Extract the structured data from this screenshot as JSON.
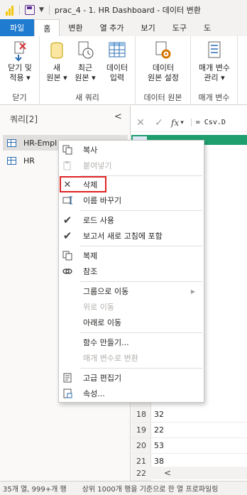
{
  "titlebar": {
    "title": "prac_4 - 1. HR Dashboard - 데이터 변환"
  },
  "tabs": [
    {
      "label": "파일"
    },
    {
      "label": "홈"
    },
    {
      "label": "변환"
    },
    {
      "label": "열 추가"
    },
    {
      "label": "보기"
    },
    {
      "label": "도구"
    },
    {
      "label": "도"
    }
  ],
  "ribbon": {
    "close_apply": {
      "line1": "닫기 및",
      "line2": "적용 ▾",
      "group": "닫기"
    },
    "new_source": {
      "line1": "새",
      "line2": "원본 ▾"
    },
    "recent_source": {
      "line1": "최근",
      "line2": "원본 ▾"
    },
    "enter_data": {
      "line1": "데이터",
      "line2": "입력"
    },
    "new_query_group": "새 쿼리",
    "data_source_settings": {
      "line1": "데이터",
      "line2": "원본 설정"
    },
    "data_source_group": "데이터 원본",
    "manage_params": {
      "line1": "매개 변수",
      "line2": "관리 ▾"
    },
    "params_group": "매개 변수"
  },
  "queries": {
    "header": "쿼리[2]",
    "items": [
      {
        "label": "HR-Empl"
      },
      {
        "label": "HR"
      }
    ]
  },
  "formula": {
    "fx": "fx",
    "text": "= Csv.D"
  },
  "grid": {
    "rows": [
      {
        "num": "18",
        "value": "32"
      },
      {
        "num": "19",
        "value": "22"
      },
      {
        "num": "20",
        "value": "53"
      },
      {
        "num": "21",
        "value": "38"
      },
      {
        "num": "22",
        "value": ""
      }
    ]
  },
  "status": {
    "left": "35개 열, 999+개 행",
    "right": "상위 1000개 행을 기준으로 한 열 프로파일링"
  },
  "context_menu": {
    "items": [
      {
        "label": "복사",
        "icon": "copy-icon",
        "disabled": false
      },
      {
        "label": "붙여넣기",
        "icon": "paste-icon",
        "disabled": true
      },
      {
        "label": "삭제",
        "icon": "close-icon",
        "disabled": false
      },
      {
        "label": "이름 바꾸기",
        "icon": "rename-icon",
        "disabled": false
      },
      {
        "label": "로드 사용",
        "icon": "check-icon",
        "disabled": false
      },
      {
        "label": "보고서 새로 고침에 포함",
        "icon": "check-icon",
        "disabled": false
      },
      {
        "label": "복제",
        "icon": "duplicate-icon",
        "disabled": false
      },
      {
        "label": "참조",
        "icon": "reference-icon",
        "disabled": false
      },
      {
        "label": "그룹으로 이동",
        "icon": "",
        "disabled": false,
        "submenu": true
      },
      {
        "label": "위로 이동",
        "icon": "",
        "disabled": true
      },
      {
        "label": "아래로 이동",
        "icon": "",
        "disabled": false
      },
      {
        "label": "함수 만들기...",
        "icon": "",
        "disabled": false
      },
      {
        "label": "매개 변수로 변환",
        "icon": "",
        "disabled": true
      },
      {
        "label": "고급 편집기",
        "icon": "advanced-editor-icon",
        "disabled": false
      },
      {
        "label": "속성...",
        "icon": "properties-icon",
        "disabled": false
      }
    ],
    "highlighted": "삭제",
    "highlight_color": "#e02424"
  },
  "colors": {
    "file_tab": "#1e7bd0",
    "grid_header": "#1f9e6e",
    "powerbi_yellow": "#f2c811"
  }
}
